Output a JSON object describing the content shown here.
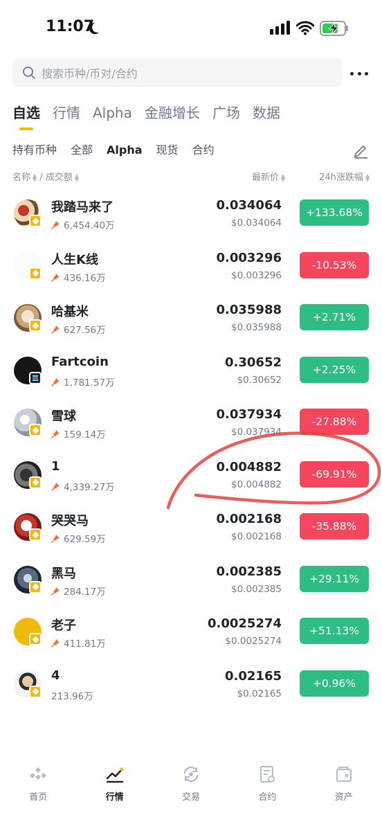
{
  "status": {
    "time": "11:07"
  },
  "search": {
    "placeholder": "搜索币种/币对/合约"
  },
  "main_tabs": [
    {
      "label": "自选",
      "active": true
    },
    {
      "label": "行情"
    },
    {
      "label": "Alpha"
    },
    {
      "label": "金融增长"
    },
    {
      "label": "广场"
    },
    {
      "label": "数据"
    }
  ],
  "sub_tabs": [
    {
      "label": "持有币种"
    },
    {
      "label": "全部"
    },
    {
      "label": "Alpha",
      "active": true
    },
    {
      "label": "现货"
    },
    {
      "label": "合约"
    }
  ],
  "columns": {
    "name": "名称",
    "separator": " / ",
    "volume": "成交额",
    "price": "最新价",
    "change": "24h涨跌幅"
  },
  "coins": [
    {
      "name": "我踏马来了",
      "volume": "6,454.40万",
      "price": "0.034064",
      "price_usd": "$0.034064",
      "change": "+133.68%",
      "direction": "up",
      "pinned": true
    },
    {
      "name": "人生K线",
      "volume": "436.16万",
      "price": "0.003296",
      "price_usd": "$0.003296",
      "change": "-10.53%",
      "direction": "down",
      "pinned": true
    },
    {
      "name": "哈基米",
      "volume": "627.56万",
      "price": "0.035988",
      "price_usd": "$0.035988",
      "change": "+2.71%",
      "direction": "up",
      "pinned": true
    },
    {
      "name": "Fartcoin",
      "volume": "1,781.57万",
      "price": "0.30652",
      "price_usd": "$0.30652",
      "change": "+2.25%",
      "direction": "up",
      "pinned": true
    },
    {
      "name": "雪球",
      "volume": "159.14万",
      "price": "0.037934",
      "price_usd": "$0.037934",
      "change": "-27.88%",
      "direction": "down",
      "pinned": true
    },
    {
      "name": "1",
      "volume": "4,339.27万",
      "price": "0.004882",
      "price_usd": "$0.004882",
      "change": "-69.91%",
      "direction": "down",
      "pinned": true
    },
    {
      "name": "哭哭马",
      "volume": "629.59万",
      "price": "0.002168",
      "price_usd": "$0.002168",
      "change": "-35.88%",
      "direction": "down",
      "pinned": true
    },
    {
      "name": "黑马",
      "volume": "284.17万",
      "price": "0.002385",
      "price_usd": "$0.002385",
      "change": "+29.11%",
      "direction": "up",
      "pinned": true
    },
    {
      "name": "老子",
      "volume": "411.81万",
      "price": "0.0025274",
      "price_usd": "$0.0025274",
      "change": "+51.13%",
      "direction": "up",
      "pinned": true
    },
    {
      "name": "4",
      "volume": "213.96万",
      "price": "0.02165",
      "price_usd": "$0.02165",
      "change": "+0.96%",
      "direction": "up",
      "pinned": false
    }
  ],
  "bottom_nav": [
    {
      "label": "首页",
      "icon": "home-icon"
    },
    {
      "label": "行情",
      "icon": "markets-icon",
      "active": true
    },
    {
      "label": "交易",
      "icon": "trade-icon"
    },
    {
      "label": "合约",
      "icon": "futures-icon"
    },
    {
      "label": "资产",
      "icon": "wallet-icon"
    }
  ],
  "colors": {
    "up": "#2ebd85",
    "down": "#f6465d",
    "accent": "#f0b90b",
    "annotation": "#e8403f"
  }
}
